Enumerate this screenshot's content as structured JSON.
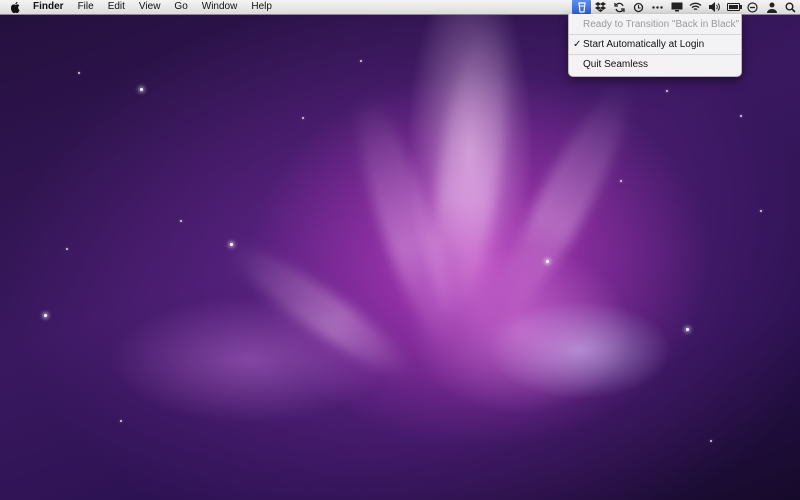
{
  "menubar": {
    "apple_icon": "apple-logo-icon",
    "app_name": "Finder",
    "menus": [
      "File",
      "Edit",
      "View",
      "Go",
      "Window",
      "Help"
    ]
  },
  "status_icons": {
    "seamless": "seamless-app-icon",
    "dropbox": "dropbox-icon",
    "sync": "sync-icon",
    "time_machine": "time-machine-icon",
    "more": "ellipsis-icon",
    "display": "display-icon",
    "wifi": "wifi-icon",
    "volume": "volume-icon",
    "battery": "battery-icon",
    "clock": "clock-icon",
    "user": "user-icon",
    "spotlight": "spotlight-search-icon"
  },
  "dropdown": {
    "status_text": "Ready to Transition \"Back in Black\"",
    "check_mark": "✓",
    "start_auto": "Start Automatically at Login",
    "quit": "Quit Seamless"
  },
  "colors": {
    "highlight": "#2e5fd6",
    "wallpaper_primary": "#c43cc4",
    "wallpaper_dark": "#23103d"
  }
}
